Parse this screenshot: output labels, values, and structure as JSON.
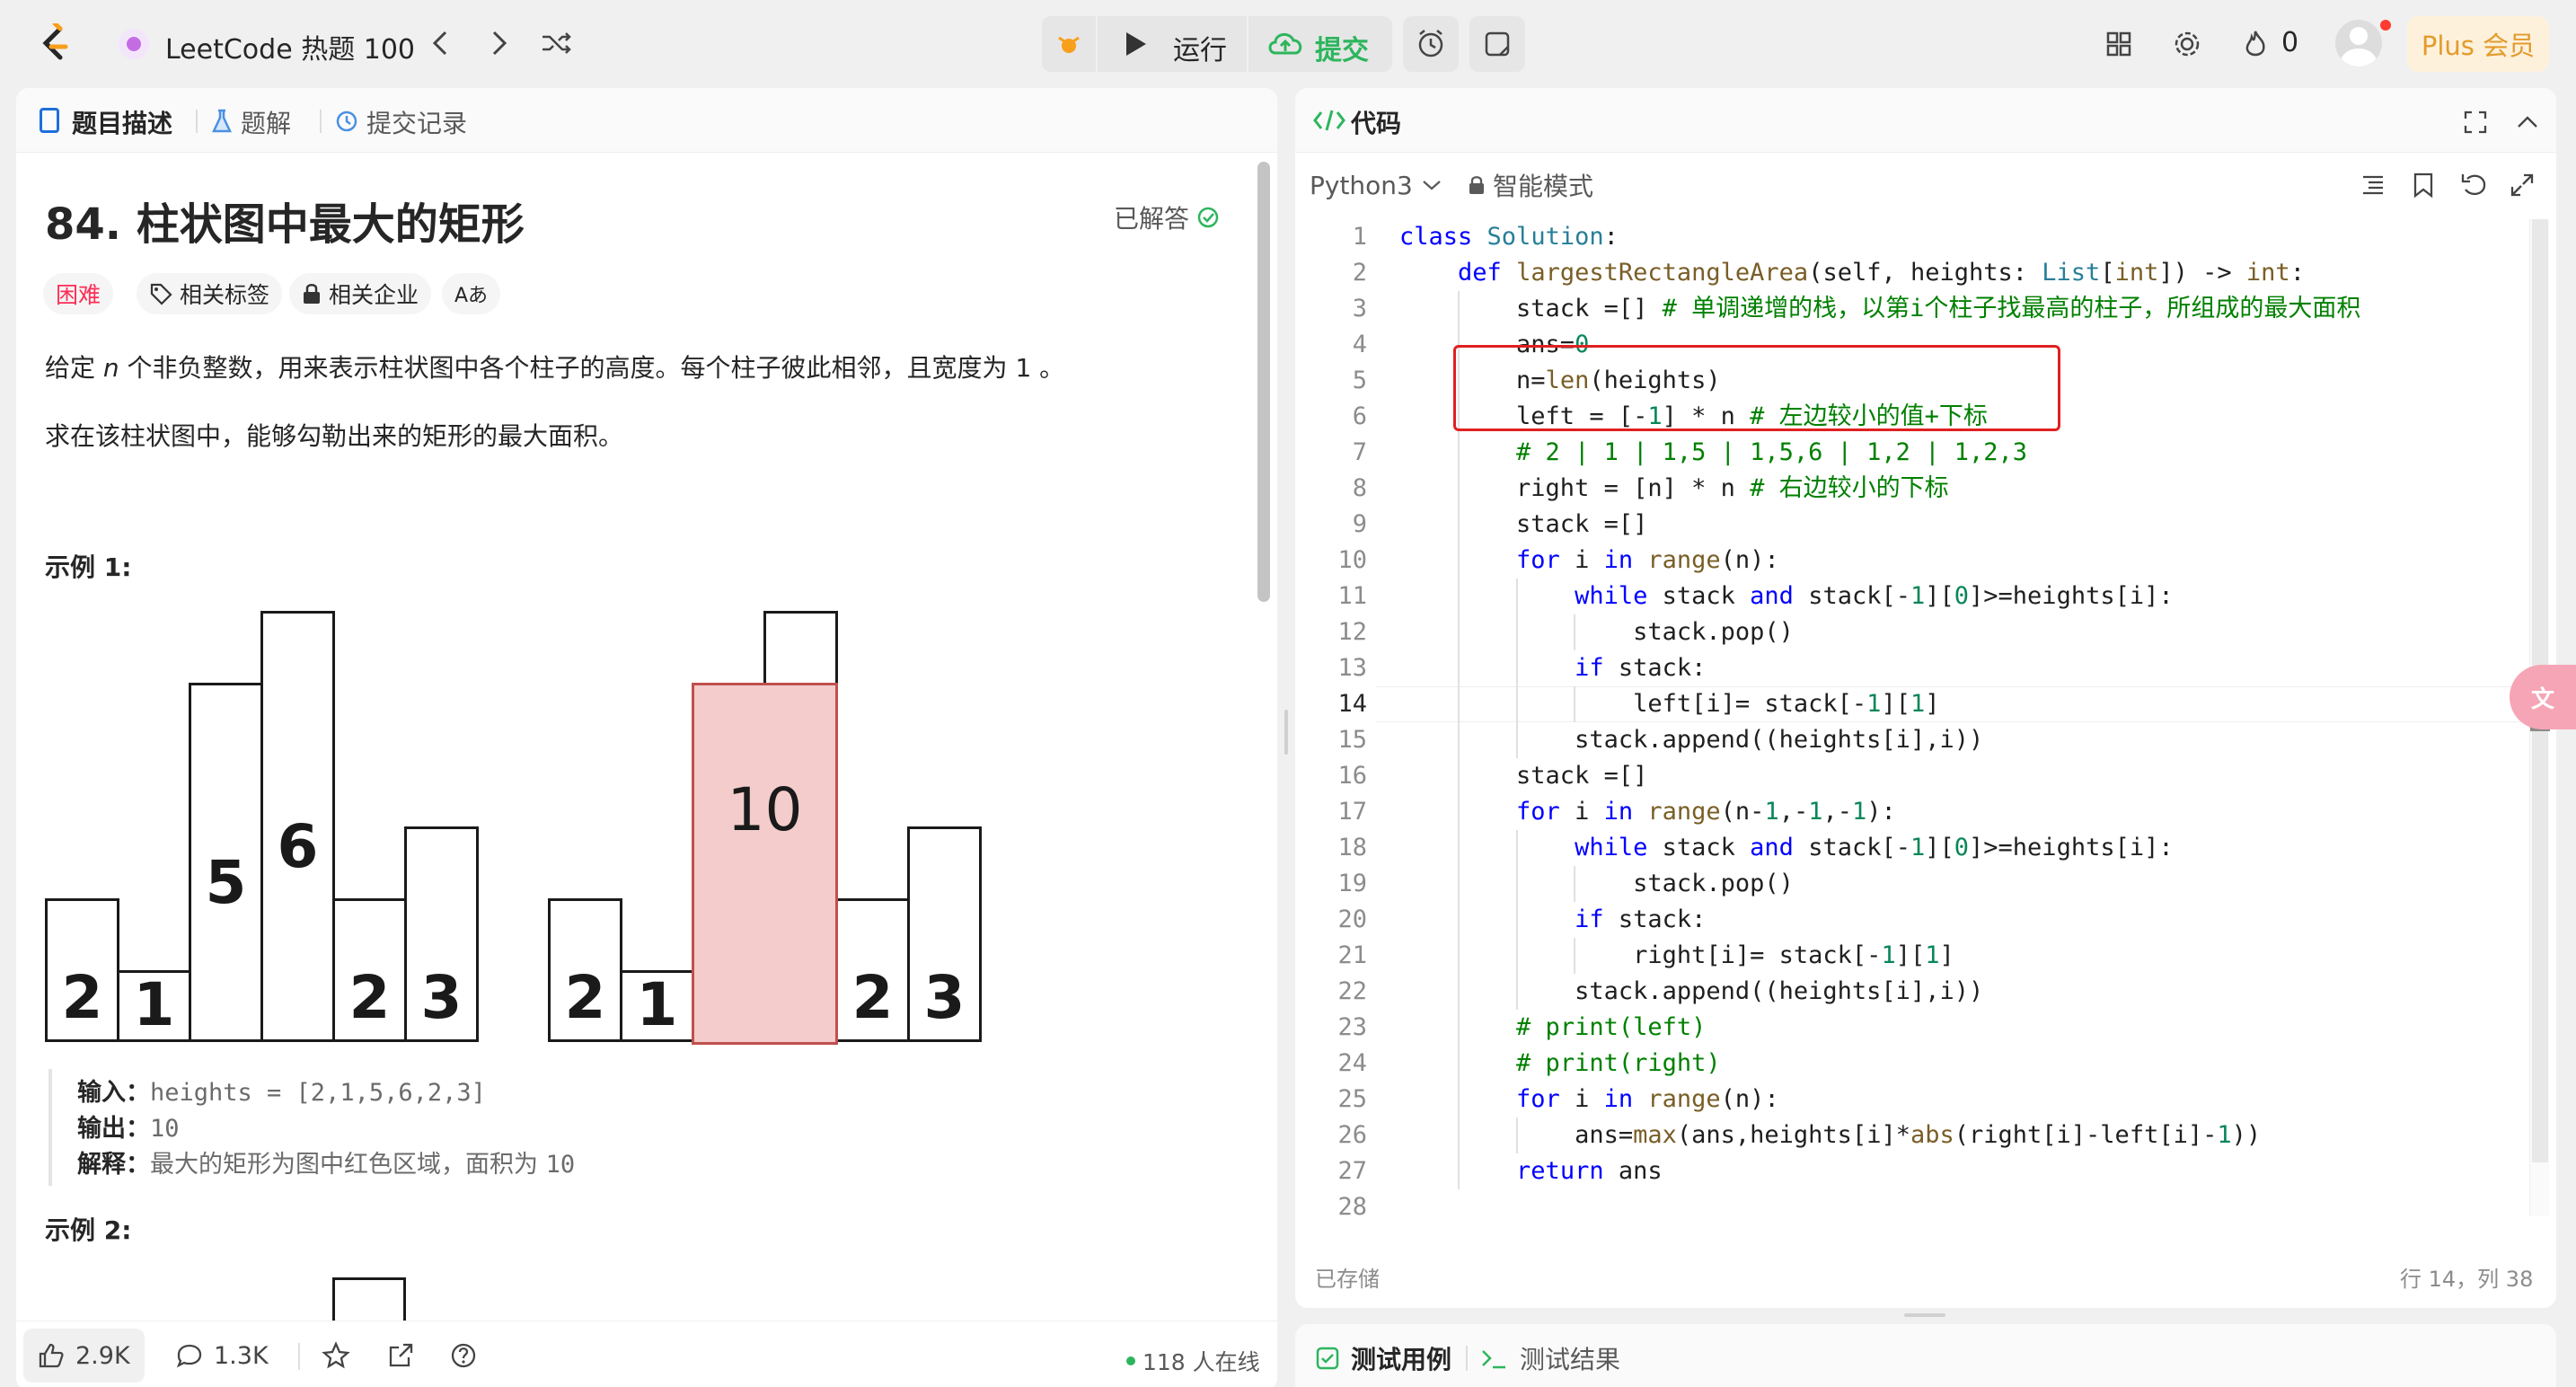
{
  "nav": {
    "title": "LeetCode 热题 100",
    "run_label": "运行",
    "submit_label": "提交",
    "fire_count": "0",
    "plus_label": "Plus 会员"
  },
  "left_tabs": [
    "题目描述",
    "题解",
    "提交记录"
  ],
  "problem": {
    "title": "84. 柱状图中最大的矩形",
    "status": "已解答",
    "tags": {
      "difficulty": "困难",
      "related_tags": "相关标签",
      "related_companies": "相关企业",
      "font": "Aあ"
    },
    "desc_prefix": "给定 ",
    "desc_var": "n",
    "desc_suffix": " 个非负整数，用来表示柱状图中各个柱子的高度。每个柱子彼此相邻，且宽度为 1 。",
    "desc2": "求在该柱状图中，能够勾勒出来的矩形的最大面积。",
    "example1_title": "示例 1:",
    "example2_title": "示例 2:",
    "input_label": "输入：",
    "input_value": "heights = [2,1,5,6,2,3]",
    "output_label": "输出：",
    "output_value": "10",
    "explain_label": "解释：",
    "explain_text": "最大的矩形为图中红色区域，面积为 ",
    "explain_value": "10"
  },
  "histogram": {
    "heights": [
      2,
      1,
      5,
      6,
      2,
      3
    ],
    "highlight_label": "10",
    "highlight_color": "#f4cccc",
    "highlight_border": "#c0504d"
  },
  "bottom_bar": {
    "likes": "2.9K",
    "comments": "1.3K",
    "online": "118 人在线"
  },
  "code_panel": {
    "title": "代码",
    "language": "Python3",
    "mode": "智能模式",
    "saved": "已存储",
    "cursor": "行 14，列 38"
  },
  "code_lines": [
    "class Solution:",
    "    def largestRectangleArea(self, heights: List[int]) -> int:",
    "        stack =[] # 单调递增的栈，以第i个柱子找最高的柱子，所组成的最大面积",
    "        ans=0",
    "        n=len(heights)",
    "        left = [-1] * n # 左边较小的值+下标",
    "        # 2 | 1 | 1,5 | 1,5,6 | 1,2 | 1,2,3",
    "        right = [n] * n # 右边较小的下标",
    "        stack =[]",
    "        for i in range(n):",
    "            while stack and stack[-1][0]>=heights[i]:",
    "                stack.pop()",
    "            if stack:",
    "                left[i]= stack[-1][1]",
    "            stack.append((heights[i],i))",
    "        stack =[]",
    "        for i in range(n-1,-1,-1):",
    "            while stack and stack[-1][0]>=heights[i]:",
    "                stack.pop()",
    "            if stack:",
    "                right[i]= stack[-1][1]",
    "            stack.append((heights[i],i))",
    "        # print(left)",
    "        # print(right)",
    "        for i in range(n):",
    "            ans=max(ans,heights[i]*abs(right[i]-left[i]-1))",
    "        return ans",
    ""
  ],
  "bottom_tabs": [
    "测试用例",
    "测试结果"
  ],
  "colors": {
    "keyword": "#0000ff",
    "comment": "#008000",
    "number": "#098658",
    "builtin": "#795e26",
    "accent_green": "#2db55d",
    "difficulty": "#ff2d55"
  }
}
